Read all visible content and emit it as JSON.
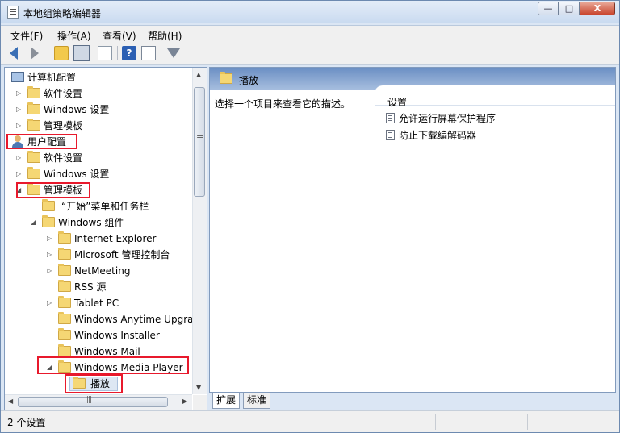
{
  "window": {
    "title": "本地组策略编辑器",
    "min": "—",
    "max": "□",
    "close": "X"
  },
  "menu": [
    "文件(F)",
    "操作(A)",
    "查看(V)",
    "帮助(H)"
  ],
  "toolbar_icons": [
    "back-icon",
    "forward-icon",
    "up-folder-icon",
    "show-hide-tree-icon",
    "export-list-icon",
    "help-icon",
    "properties-icon",
    "filter-icon"
  ],
  "tree": {
    "computer": "计算机配置",
    "c_software": "软件设置",
    "c_windows": "Windows 设置",
    "c_admin": "管理模板",
    "user": "用户配置",
    "u_software": "软件设置",
    "u_windows": "Windows 设置",
    "u_admin": "管理模板",
    "start_menu": "“开始”菜单和任务栏",
    "win_components": "Windows 组件",
    "ie": "Internet Explorer",
    "mmc": "Microsoft 管理控制台",
    "netmeeting": "NetMeeting",
    "rss": "RSS 源",
    "tablet": "Tablet PC",
    "anytime": "Windows Anytime Upgra",
    "installer": "Windows Installer",
    "mail": "Windows Mail",
    "wmp": "Windows Media Player",
    "playback": "播放"
  },
  "right": {
    "header": "播放",
    "description": "选择一个项目来查看它的描述。",
    "settings_col": "设置",
    "policies": [
      "允许运行屏幕保护程序",
      "防止下载编解码器"
    ]
  },
  "tabs": [
    "扩展",
    "标准"
  ],
  "status": "2 个设置",
  "colors": {
    "highlight": "#e8192c",
    "header_blue": "#6b8fc4",
    "folder": "#f5d774"
  }
}
